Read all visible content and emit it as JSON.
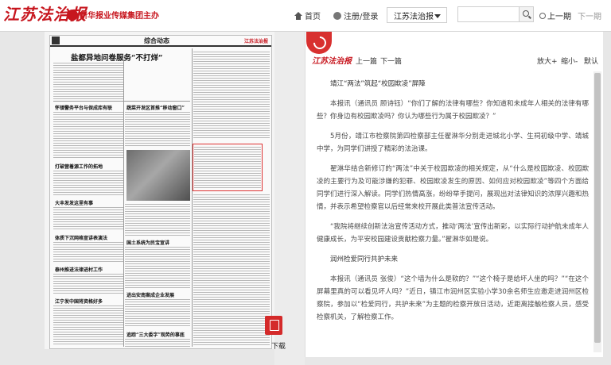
{
  "header": {
    "logo_text": "江苏法治报",
    "logo_sub": "新华报业传媒集团主办",
    "nav_home": "首页",
    "nav_login": "注册/登录",
    "paper_select_value": "江苏法治报",
    "search_placeholder": "",
    "prev_page": "上一期",
    "next_page": "下一期",
    "brand_color": "#c7161e"
  },
  "newspaper_page": {
    "section": "综合动态",
    "headline": "盐都异地问卷服务“不打烊”",
    "subheads": [
      "怀镇警务平台与保成库有联",
      "蔬菜开发区首推“移动窗口”",
      "打破营着源工作的拓地",
      "大丰发发这里有事",
      "体质下沉网格宣讲表演法",
      "国土系统为民宝宣讲",
      "泰州推进法律进村工作",
      "进出安南案成企业发展",
      "江宁发中国将资格好多",
      "追踪“三大委字”观势的事底"
    ],
    "brand": "江苏法治报"
  },
  "sidebar": {
    "download_label": "下载"
  },
  "reader": {
    "logo_text": "江苏法治报",
    "prev_article": "上一篇",
    "next_article": "下一篇",
    "zoom_in": "放大+",
    "zoom_out": "缩小-",
    "zoom_default": "默认",
    "article": {
      "title": "靖江“两法”筑起“校园欺凌”屏障",
      "p1": "本报讯（通讯员 顾诗钰）“你们了解的法律有哪些？你知道和未成年人相关的法律有哪些？你身边有校园欺凌吗？你认为哪些行为属于校园欺凌？”",
      "p2": "5月份，靖江市检察院第四检察部主任翟淋华分别走进城北小学、生祠初级中学、靖城中学，为同学们讲授了精彩的法治课。",
      "p3": "翟淋华结合新修订的“两法”中关于校园欺凌的相关规定，从“什么是校园欺凌、校园欺凌的主要行为及可能涉嫌的犯罪、校园欺凌发生的原因、如何应对校园欺凌”等四个方面给同学们进行深入解读。同学们热情高涨，纷纷举手提问，展现出对法律知识的浓厚兴趣和热情，并表示希望检察官以后经常来校开展此类普法宣传活动。",
      "p4": "“我院将继续创新法治宣传活动方式，推动‘两法’宣传出新彩，以实际行动护航未成年人健康成长，为平安校园建设贡献检察力量。”翟淋华如是说。",
      "heading2": "润州检爱同行共护未来",
      "p5": "本报讯（通讯员 张俊）“这个墙为什么是软的？”“这个椅子是给坏人坐的吗？”“在这个屏幕里真的可以看见坏人吗？”近日，镇江市润州区实验小学30余名师生应邀走进润州区检察院，参加以“检爱同行，共护未来”为主题的检察开放日活动，近距离接触检察人员，感受检察机关，了解检察工作。"
    }
  }
}
